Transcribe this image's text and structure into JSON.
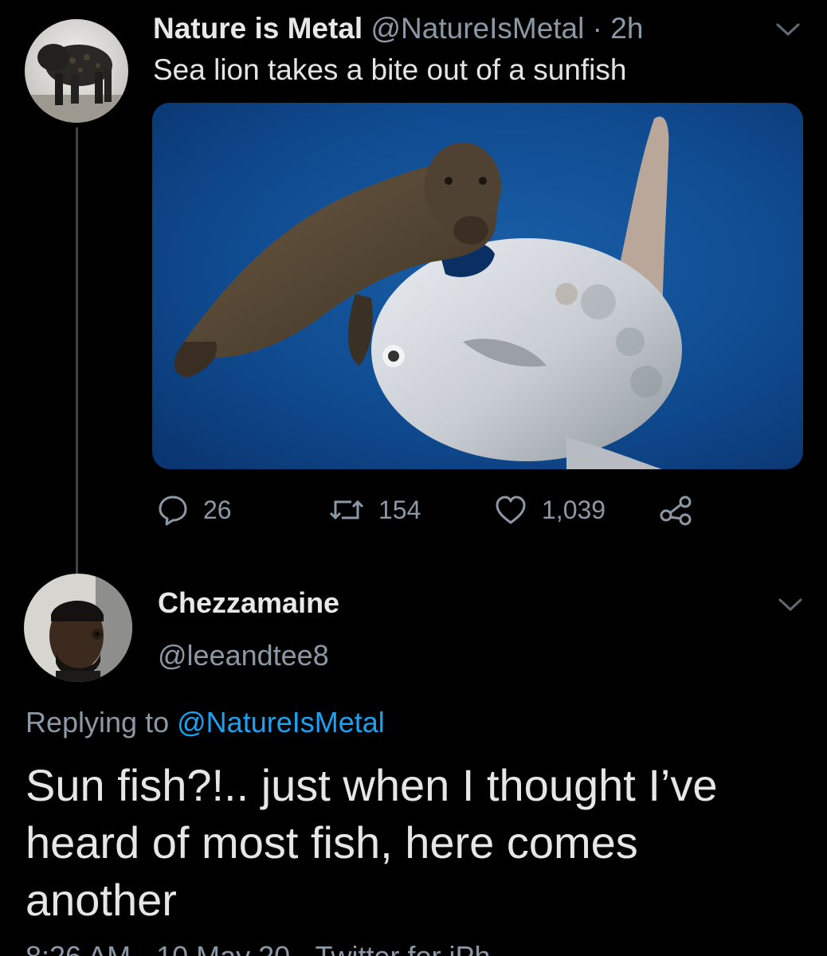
{
  "colors": {
    "background": "#000000",
    "primary_text": "#e6e6e6",
    "secondary_text": "#8b98a5",
    "link": "#1da1f2"
  },
  "original_tweet": {
    "display_name": "Nature is Metal",
    "handle": "@NatureIsMetal",
    "separator": "·",
    "time": "2h",
    "text": "Sea lion takes a bite out of a sunfish",
    "avatar_icon": "black-jaguar-avatar",
    "menu_icon": "chevron-down-icon",
    "media_icon": "sea-lion-sunfish-photo",
    "stats": {
      "replies": "26",
      "retweets": "154",
      "likes": "1,039"
    }
  },
  "reply_tweet": {
    "display_name": "Chezzamaine",
    "handle": "@leeandtee8",
    "replying_prefix": "Replying to",
    "replying_handle": "@NatureIsMetal",
    "text": "Sun fish?!.. just when I thought I’ve heard of most fish, here comes another",
    "avatar_icon": "man-profile-avatar",
    "menu_icon": "chevron-down-icon",
    "meta_partial": "8:26 AM · 10 May 20 · Twitter for iPh"
  }
}
